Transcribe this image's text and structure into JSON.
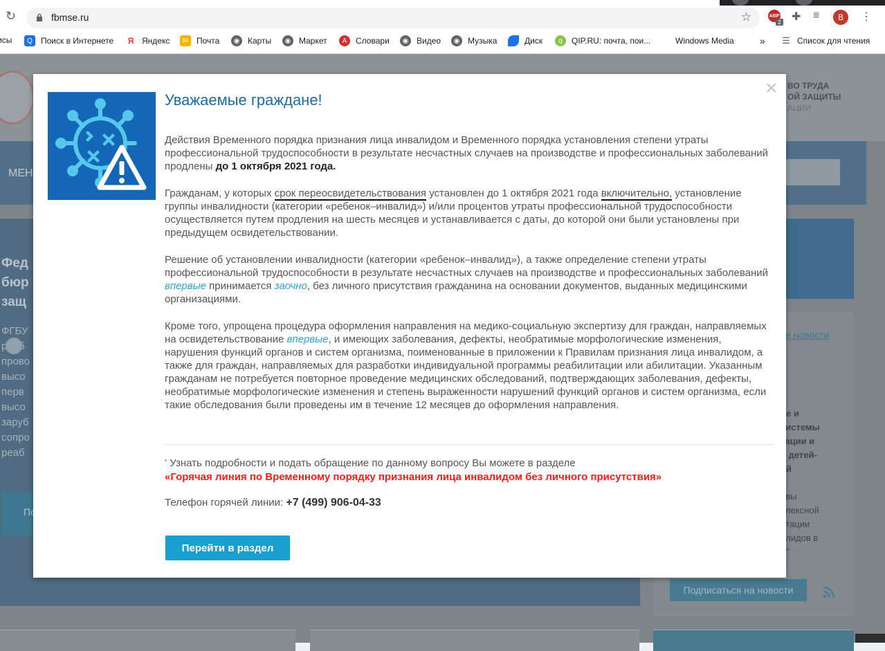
{
  "browser": {
    "url": "fbmse.ru",
    "profile_initial": "B",
    "ext_badge_label": "ABP",
    "ext_badge_count": "2",
    "bookmarks": [
      {
        "label": "исы",
        "icon": "partial-icon",
        "color": "#ffffff"
      },
      {
        "label": "Поиск в Интернете",
        "icon": "search-icon",
        "color": "#1a73e8"
      },
      {
        "label": "Яндекс",
        "icon": "yandex-icon",
        "color": "#ff3333"
      },
      {
        "label": "Почта",
        "icon": "mail-icon",
        "color": "#f7b500"
      },
      {
        "label": "Карты",
        "icon": "globe-icon",
        "color": "#5f6368"
      },
      {
        "label": "Маркет",
        "icon": "globe-icon",
        "color": "#5f6368"
      },
      {
        "label": "Словари",
        "icon": "dictionary-icon",
        "color": "#d32f2f"
      },
      {
        "label": "Видео",
        "icon": "globe-icon",
        "color": "#5f6368"
      },
      {
        "label": "Музыка",
        "icon": "globe-icon",
        "color": "#5f6368"
      },
      {
        "label": "Диск",
        "icon": "disk-icon",
        "color": "#1a73e8"
      },
      {
        "label": "QIP.RU: почта, пои...",
        "icon": "qip-icon",
        "color": "#8bc34a"
      },
      {
        "label": "Windows Media",
        "icon": "windows-icon",
        "color": "#f25022"
      }
    ],
    "reading_list": "Список для чтения"
  },
  "site": {
    "nav_menu": "МЕН",
    "org_lines": [
      "ВО ТРУДА",
      "ОЙ ЗАЩИТЫ",
      "АЦИИ"
    ],
    "hero_title_lines": [
      "Фед",
      "бюр",
      "защ"
    ],
    "hero_text_lines": [
      "ФГБУ",
      "реаб",
      "прово",
      "высо",
      "перв",
      "высо",
      "заруб",
      "сопро",
      "реаб"
    ],
    "hero_button": "По",
    "news_link": "се новости",
    "news_lines": [
      "ие и",
      "системы",
      "тации и",
      "и детей-",
      "ой",
      "",
      "ивы",
      "плексной",
      "итации",
      "алидов в",
      "и\""
    ],
    "subscribe_button": "Подписаться на новости"
  },
  "modal": {
    "title": "Уважаемые граждане!",
    "p1_text": "Действия Временного порядка признания лица инвалидом и Временного порядка установления степени утраты профессиональной трудоспособности в результате несчастных случаев на производстве и профессиональных заболеваний продлены ",
    "p1_bold": "до 1 октября 2021 года.",
    "p2_a": "Гражданам, у которых ",
    "p2_mark1": "срок переосвидетельствования",
    "p2_b": " установлен до 1 октября 2021 года ",
    "p2_mark2": "включительно,",
    "p2_c": " установление группы инвалидности (категории «ребенок–инвалид») и/или процентов утраты профессиональной трудоспособности осуществляется путем продления на шесть месяцев и устанавливается с даты, до которой они были установлены при предыдущем освидетельствовании.",
    "p3_a": "Решение об установлении инвалидности (категории «ребенок–инвалид»), а также определение степени утраты профессиональной трудоспособности в результате несчастных случаев на производстве и профессиональных заболеваний ",
    "p3_em1": "впервые",
    "p3_b": " принимается ",
    "p3_em2": "заочно",
    "p3_c": ", без личного присутствия гражданина на основании документов, выданных медицинскими организациями.",
    "p4_a": "Кроме того, упрощена процедура оформления направления на медико-социальную экспертизу для граждан, направляемых на освидетельствование ",
    "p4_em": "впервые",
    "p4_b": ", и имеющих заболевания, дефекты, необратимые морфологические изменения, нарушения функций органов и систем организма, поименованные в приложении к Правилам признания лица инвалидом, а также для граждан, направляемых для разработки индивидуальной программы реабилитации или абилитации. Указанным гражданам не потребуется повторное проведение медицинских обследований, подтверждающих заболевания, дефекты, необратимые морфологические изменения и степень выраженности нарушений функций органов и систем организма, если такие обследования были проведены им в течение 12 месяцев до оформления направления.",
    "note_star": "*",
    "note_text": " Узнать подробности и подать обращение по данному вопросу Вы можете в разделе",
    "hotline_link": "«Горячая линия по Временному порядку признания лица инвалидом без личного присутствия»",
    "phone_label": "Телефон горячей линии: ",
    "phone_number": "+7 (499) 906-04-33",
    "go_button": "Перейти в раздел",
    "close_glyph": "×"
  }
}
